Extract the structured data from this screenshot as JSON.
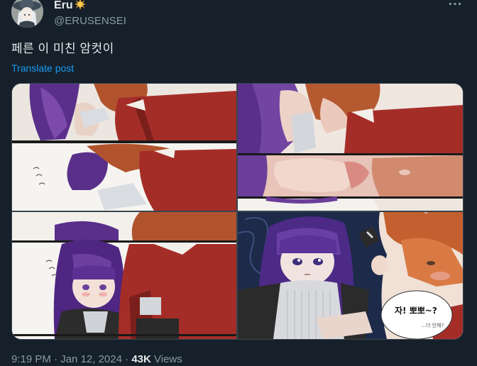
{
  "author": {
    "display_name": "Eru",
    "handle": "@ERUSENSEI",
    "badge_icon": "sun-emoji-icon",
    "avatar_icon": "avatar-image"
  },
  "tweet": {
    "text": "페른 이 미친 암컷이",
    "translate_label": "Translate post"
  },
  "media": {
    "panels": [
      {
        "icon": "manga-panel-image"
      },
      {
        "icon": "manga-panel-image"
      },
      {
        "icon": "manga-panel-image"
      },
      {
        "icon": "manga-panel-image"
      }
    ],
    "speech_bubble": "자! 뽀뽀~?",
    "speech_small": "…더 안해?"
  },
  "meta": {
    "time": "9:19 PM",
    "separator": " · ",
    "date": "Jan 12, 2024",
    "views_count": "43K",
    "views_label": " Views"
  },
  "colors": {
    "background": "#15202b",
    "text_primary": "#e7e9ea",
    "text_secondary": "#8b98a5",
    "link": "#1d9bf0"
  }
}
